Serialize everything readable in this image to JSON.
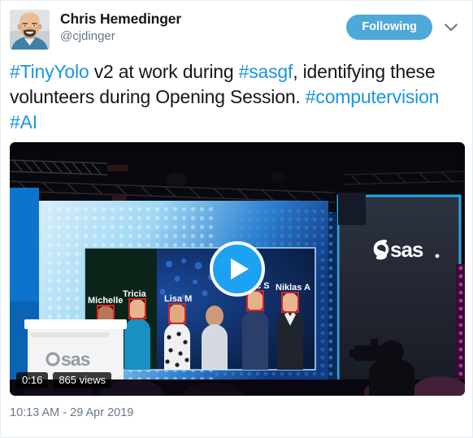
{
  "author": {
    "display_name": "Chris Hemedinger",
    "handle": "@cjdinger",
    "avatar_alt": "avatar"
  },
  "header": {
    "follow_label": "Following",
    "caret_icon": "chevron-down-icon"
  },
  "tweet": {
    "segments": [
      {
        "type": "link",
        "text": "#TinyYolo"
      },
      {
        "type": "text",
        "text": " v2 at work during "
      },
      {
        "type": "link",
        "text": "#sasgf"
      },
      {
        "type": "text",
        "text": ", identifying these volunteers during Opening Session. "
      },
      {
        "type": "link",
        "text": "#computervision"
      },
      {
        "type": "text",
        "text": " "
      },
      {
        "type": "link",
        "text": "#AI"
      }
    ],
    "text_plain": "#TinyYolo v2 at work during #sasgf, identifying these volunteers during Opening Session. #computervision #AI"
  },
  "media": {
    "type": "video",
    "play_icon": "play-icon",
    "duration_badge": "0:16",
    "views_badge": "865 views",
    "scene": {
      "description": "Conference stage with large LED video wall showing face detection",
      "brand_text": "sas",
      "face_labels": [
        "Michelle",
        "Tricia",
        "Lisa M",
        "Alec S",
        "Niklas A"
      ]
    }
  },
  "footer": {
    "timestamp": "10:13 AM - 29 Apr 2019"
  },
  "colors": {
    "link_blue": "#1b95e0",
    "follow_blue": "#4fa9d8",
    "play_blue": "#1da1f2",
    "text_dark": "#14171a",
    "text_muted": "#697886",
    "card_border": "#e6ecf0",
    "detection_box": "#e02020"
  }
}
